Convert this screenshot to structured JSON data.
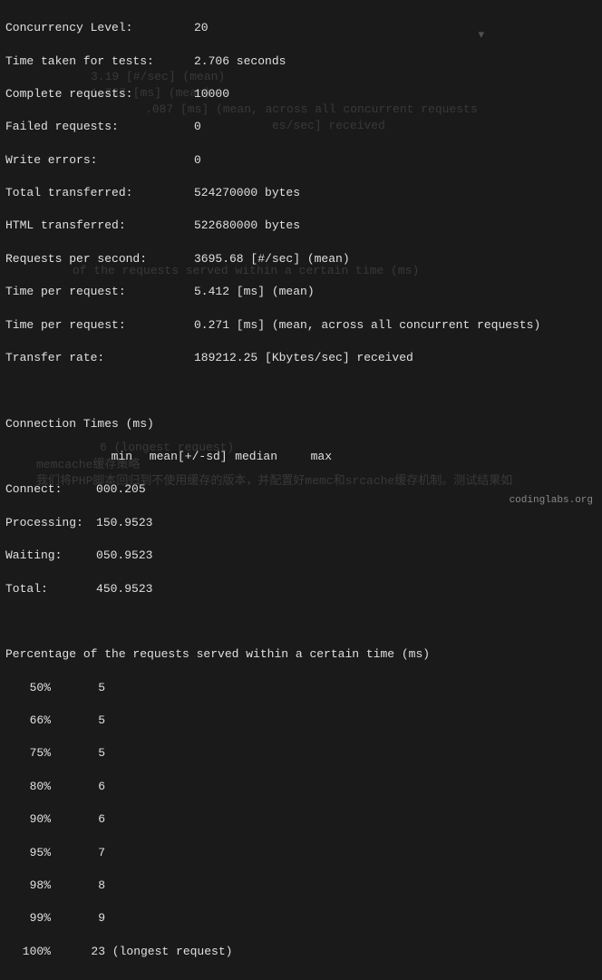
{
  "stats": {
    "concurrency_label": "Concurrency Level:",
    "concurrency_value": "20",
    "time_taken_label": "Time taken for tests:",
    "time_taken_value": "2.706 seconds",
    "complete_label": "Complete requests:",
    "complete_value": "10000",
    "failed_label": "Failed requests:",
    "failed_value": "0",
    "write_errors_label": "Write errors:",
    "write_errors_value": "0",
    "total_transferred_label": "Total transferred:",
    "total_transferred_value": "524270000 bytes",
    "html_transferred_label": "HTML transferred:",
    "html_transferred_value": "522680000 bytes",
    "rps_label": "Requests per second:",
    "rps_value": "3695.68 [#/sec] (mean)",
    "tpr1_label": "Time per request:",
    "tpr1_value": "5.412 [ms] (mean)",
    "tpr2_label": "Time per request:",
    "tpr2_value": "0.271 [ms] (mean, across all concurrent requests)",
    "transfer_label": "Transfer rate:",
    "transfer_value": "189212.25 [Kbytes/sec] received"
  },
  "conn_times": {
    "title": "Connection Times (ms)",
    "headers": {
      "min": "min",
      "mean": "mean",
      "sd": "[+/-sd]",
      "median": "median",
      "max": "max"
    },
    "rows": [
      {
        "label": "Connect:",
        "min": "0",
        "mean": "0",
        "sd": "0.2",
        "median": "0",
        "max": "5"
      },
      {
        "label": "Processing:",
        "min": "1",
        "mean": "5",
        "sd": "0.9",
        "median": "5",
        "max": "23"
      },
      {
        "label": "Waiting:",
        "min": "0",
        "mean": "5",
        "sd": "0.9",
        "median": "5",
        "max": "23"
      },
      {
        "label": "Total:",
        "min": "4",
        "mean": "5",
        "sd": "0.9",
        "median": "5",
        "max": "23"
      }
    ]
  },
  "percentages": {
    "title": "Percentage of the requests served within a certain time (ms)",
    "rows": [
      {
        "pct": "50%",
        "val": "5",
        "suffix": ""
      },
      {
        "pct": "66%",
        "val": "5",
        "suffix": ""
      },
      {
        "pct": "75%",
        "val": "5",
        "suffix": ""
      },
      {
        "pct": "80%",
        "val": "6",
        "suffix": ""
      },
      {
        "pct": "90%",
        "val": "6",
        "suffix": ""
      },
      {
        "pct": "95%",
        "val": "7",
        "suffix": ""
      },
      {
        "pct": "98%",
        "val": "8",
        "suffix": ""
      },
      {
        "pct": "99%",
        "val": "9",
        "suffix": ""
      },
      {
        "pct": "100%",
        "val": "23",
        "suffix": " (longest request)"
      }
    ]
  },
  "ghost": {
    "g1": "3.19 [#/sec] (mean)",
    "g2": "1.737 [ms] (mean)",
    "g3": ".087 [ms] (mean, across all concurrent requests",
    "g4": "es/sec] received",
    "g5": "of the requests served within a certain time (ms)",
    "g6": "6 (longest request)",
    "g7": "memcache缓存策略",
    "g8": "我们将PHP脚本回归到不使用缓存的版本，并配置好memc和srcache缓存机制。测试结果如"
  },
  "footer": "codinglabs.org",
  "dropdown_icon": "▾"
}
